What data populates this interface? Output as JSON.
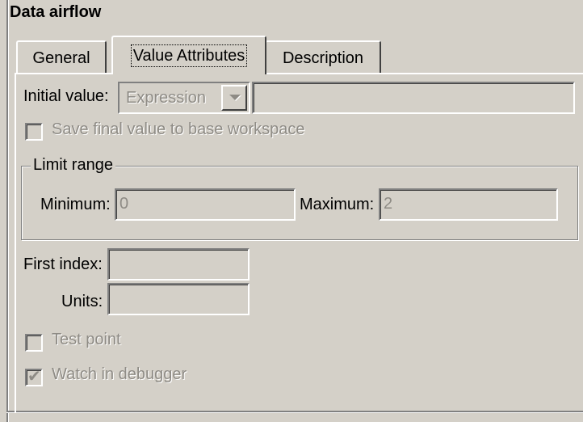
{
  "window": {
    "title": "Data airflow"
  },
  "tabs": [
    {
      "label": "General",
      "active": false
    },
    {
      "label": "Value Attributes",
      "active": true
    },
    {
      "label": "Description",
      "active": false
    }
  ],
  "initial_value": {
    "label": "Initial value:",
    "mode": "Expression",
    "value": ""
  },
  "save_final": {
    "label": "Save final value to base workspace",
    "checked": false,
    "enabled": false
  },
  "limit_range": {
    "title": "Limit range",
    "minimum_label": "Minimum:",
    "minimum_value": "0",
    "maximum_label": "Maximum:",
    "maximum_value": "2"
  },
  "first_index": {
    "label": "First index:",
    "value": ""
  },
  "units": {
    "label": "Units:",
    "value": ""
  },
  "test_point": {
    "label": "Test point",
    "checked": false,
    "enabled": false
  },
  "watch_debugger": {
    "label": "Watch in debugger",
    "checked": true,
    "enabled": false
  },
  "icons": {
    "dropdown": "chevron-down-icon",
    "check": "checkmark-icon"
  },
  "colors": {
    "face": "#d4d0c8",
    "disabled_text": "#8e8b85"
  }
}
